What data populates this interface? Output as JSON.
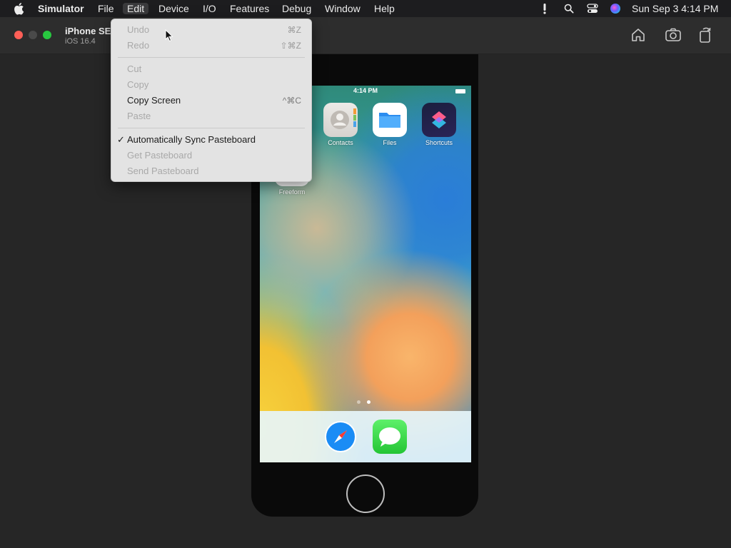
{
  "menubar": {
    "apple_icon": "apple-logo",
    "app_name": "Simulator",
    "items": [
      "File",
      "Edit",
      "Device",
      "I/O",
      "Features",
      "Debug",
      "Window",
      "Help"
    ],
    "active_item": "Edit",
    "status_icons": [
      "alert-icon",
      "search-icon",
      "control-center-icon",
      "siri-icon"
    ],
    "clock": "Sun Sep 3  4:14 PM"
  },
  "window": {
    "device_name": "iPhone SE",
    "os_version": "iOS 16.4",
    "toolbar": [
      "home-icon",
      "screenshot-icon",
      "rotate-icon"
    ]
  },
  "edit_menu": {
    "items": [
      {
        "label": "Undo",
        "shortcut": "⌘Z",
        "enabled": false
      },
      {
        "label": "Redo",
        "shortcut": "⇧⌘Z",
        "enabled": false
      },
      {
        "label": "Cut",
        "shortcut": "",
        "enabled": false
      },
      {
        "label": "Copy",
        "shortcut": "",
        "enabled": false
      },
      {
        "label": "Copy Screen",
        "shortcut": "^⌘C",
        "enabled": true
      },
      {
        "label": "Paste",
        "shortcut": "",
        "enabled": false
      },
      {
        "label": "Automatically Sync Pasteboard",
        "shortcut": "",
        "enabled": true,
        "checked": true
      },
      {
        "label": "Get Pasteboard",
        "shortcut": "",
        "enabled": false
      },
      {
        "label": "Send Pasteboard",
        "shortcut": "",
        "enabled": false
      }
    ]
  },
  "phone": {
    "time": "4:14 PM",
    "apps": [
      {
        "name": "Contacts",
        "icon": "contacts-icon"
      },
      {
        "name": "Files",
        "icon": "files-icon"
      },
      {
        "name": "Shortcuts",
        "icon": "shortcuts-icon"
      },
      {
        "name": "Freeform",
        "icon": "freeform-icon"
      }
    ],
    "dock": [
      {
        "name": "Safari",
        "icon": "safari-icon"
      },
      {
        "name": "Messages",
        "icon": "messages-icon"
      }
    ],
    "page_count": 2,
    "current_page": 2
  }
}
